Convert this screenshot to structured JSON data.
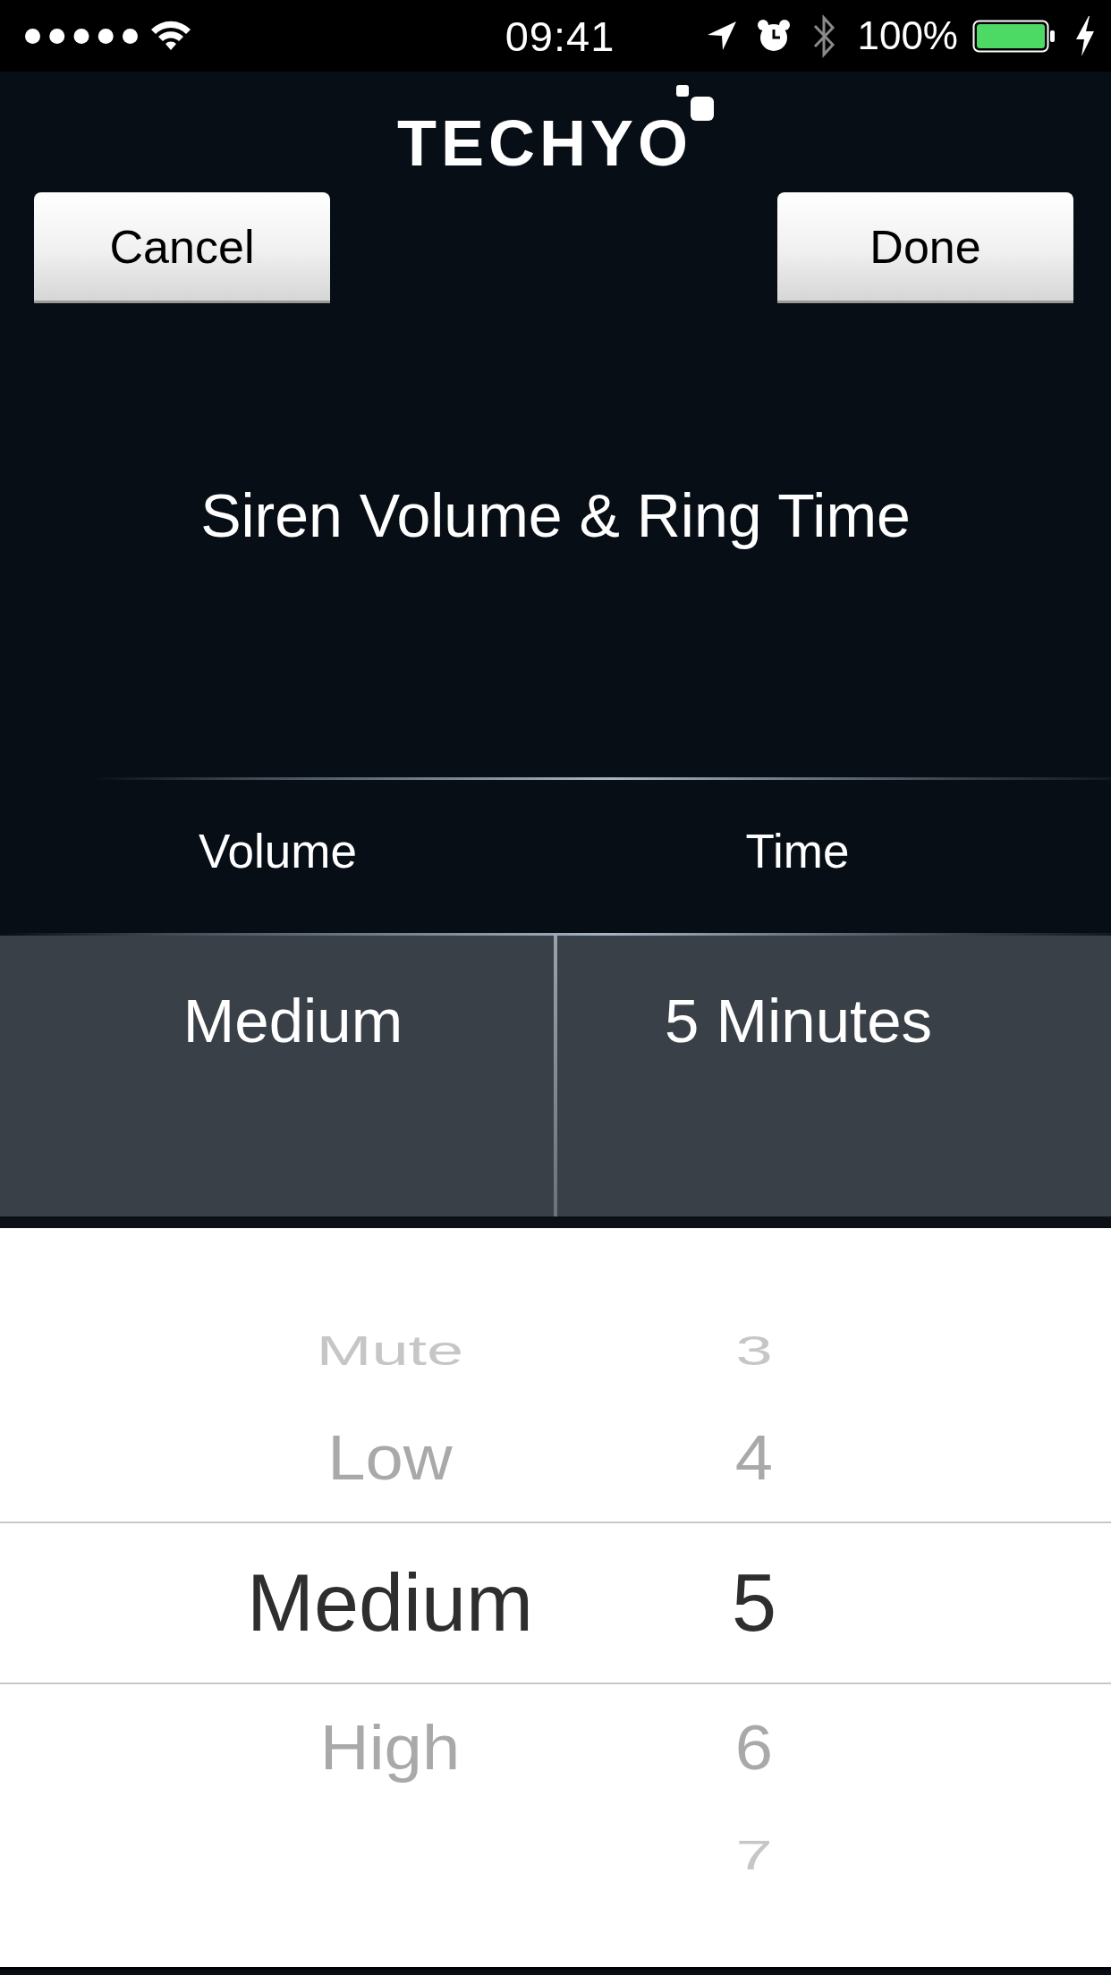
{
  "status_bar": {
    "time": "09:41",
    "battery": "100%"
  },
  "header": {
    "logo": "TECHYO",
    "buttons": [
      {
        "label": "Cancel"
      },
      {
        "label": "Done"
      }
    ]
  },
  "title": "Siren Volume & Ring Time",
  "columns": [
    {
      "header": "Volume",
      "value": "Medium"
    },
    {
      "header": "Time",
      "value": "5 Minutes"
    }
  ],
  "picker": {
    "wheels": [
      {
        "items": [
          {
            "label": "Mute",
            "selected": false
          },
          {
            "label": "Low",
            "selected": false
          },
          {
            "label": "Medium",
            "selected": true
          },
          {
            "label": "High",
            "selected": false
          }
        ]
      },
      {
        "items": [
          {
            "label": "3",
            "selected": false
          },
          {
            "label": "4",
            "selected": false
          },
          {
            "label": "5",
            "selected": true
          },
          {
            "label": "6",
            "selected": false
          },
          {
            "label": "7",
            "selected": false
          }
        ]
      }
    ]
  }
}
